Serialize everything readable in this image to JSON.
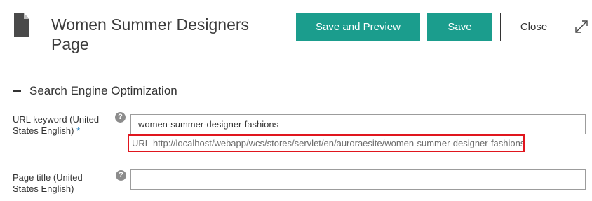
{
  "header": {
    "title": "Women Summer Designers Page",
    "page_icon": "page-document-icon",
    "expand_icon": "expand-arrows-icon"
  },
  "toolbar": {
    "save_preview_label": "Save and Preview",
    "save_label": "Save",
    "close_label": "Close"
  },
  "section": {
    "title": "Search Engine Optimization",
    "collapse_icon": "minus-icon"
  },
  "fields": {
    "url_keyword": {
      "label": "URL keyword (United States English)",
      "required_mark": "*",
      "help_icon": "question-mark-icon",
      "value": "women-summer-designer-fashions",
      "url_prefix": "URL",
      "url": "http://localhost/webapp/wcs/stores/servlet/en/auroraesite/women-summer-designer-fashions"
    },
    "page_title": {
      "label": "Page title (United States English)",
      "help_icon": "question-mark-icon",
      "value": ""
    }
  },
  "colors": {
    "primary": "#1b9d8d",
    "highlight": "#e0161e",
    "required": "#2e86c1"
  }
}
